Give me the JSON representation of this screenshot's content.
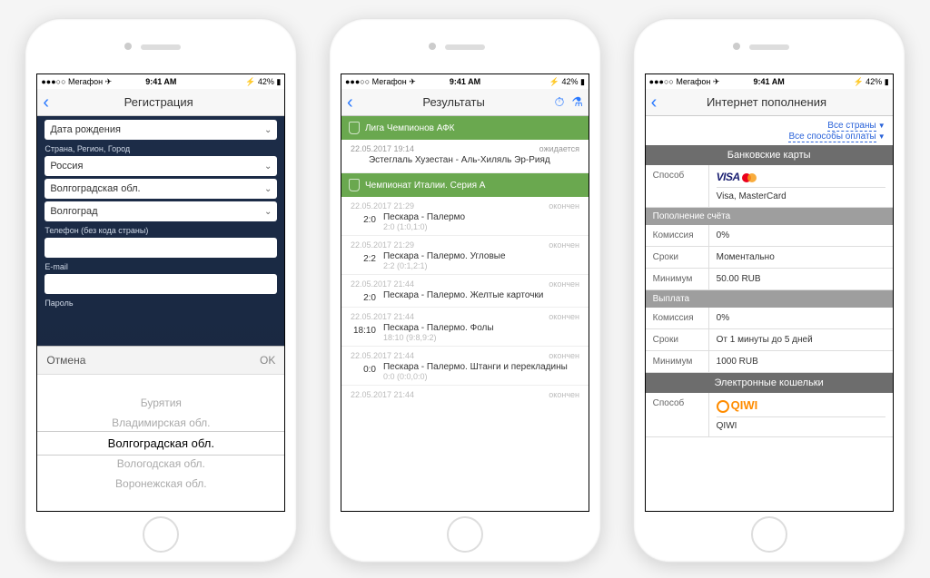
{
  "status": {
    "carrier": "Мегафон",
    "time": "9:41 AM",
    "battery": "42%"
  },
  "phone1": {
    "title": "Регистрация",
    "dob_label": "Дата рождения",
    "loc_label": "Страна, Регион, Город",
    "country": "Россия",
    "region": "Волгоградская обл.",
    "city": "Волгоград",
    "phone_label": "Телефон (без кода страны)",
    "email_label": "E-mail",
    "pwd_label": "Пароль",
    "cancel": "Отмена",
    "ok": "OK",
    "picker": [
      "Бурятия",
      "Владимирская обл.",
      "Волгоградская обл.",
      "Вологодская обл.",
      "Воронежская обл."
    ]
  },
  "phone2": {
    "title": "Результаты",
    "league1": "Лига Чемпионов АФК",
    "league2": "Чемпионат Италии. Серия А",
    "m1_time": "22.05.2017 19:14",
    "m1_status": "ожидается",
    "m1_name": "Эстеглаль Хузестан - Аль-Хиляль Эр-Рияд",
    "done": "окончен",
    "rows": [
      {
        "t": "22.05.2017 21:29",
        "s": "2:0",
        "n": "Пескара - Палермо",
        "sub": "2:0 (1:0,1:0)"
      },
      {
        "t": "22.05.2017 21:29",
        "s": "2:2",
        "n": "Пескара - Палермо. Угловые",
        "sub": "2:2 (0:1,2:1)"
      },
      {
        "t": "22.05.2017 21:44",
        "s": "2:0",
        "n": "Пескара - Палермо. Желтые карточки",
        "sub": ""
      },
      {
        "t": "22.05.2017 21:44",
        "s": "18:10",
        "n": "Пескара - Палермо. Фолы",
        "sub": "18:10 (9:8,9:2)"
      },
      {
        "t": "22.05.2017 21:44",
        "s": "0:0",
        "n": "Пескара - Палермо. Штанги и перекладины",
        "sub": "0:0 (0:0,0:0)"
      },
      {
        "t": "22.05.2017 21:44",
        "s": "",
        "n": "",
        "sub": ""
      }
    ]
  },
  "phone3": {
    "title": "Интернет пополнения",
    "filter1": "Все страны",
    "filter2": "Все способы оплаты",
    "sec1": "Банковские карты",
    "method_k": "Способ",
    "method_v": "Visa, MasterCard",
    "topup": "Пополнение счёта",
    "fee_k": "Комиссия",
    "fee_v": "0%",
    "time_k": "Сроки",
    "time_v": "Моментально",
    "min_k": "Минимум",
    "min_v": "50.00 RUB",
    "payout": "Выплата",
    "p_fee": "0%",
    "p_time": "От 1 минуты до 5 дней",
    "p_min": "1000 RUB",
    "sec2": "Электронные кошельки",
    "qiwi_v": "QIWI"
  }
}
